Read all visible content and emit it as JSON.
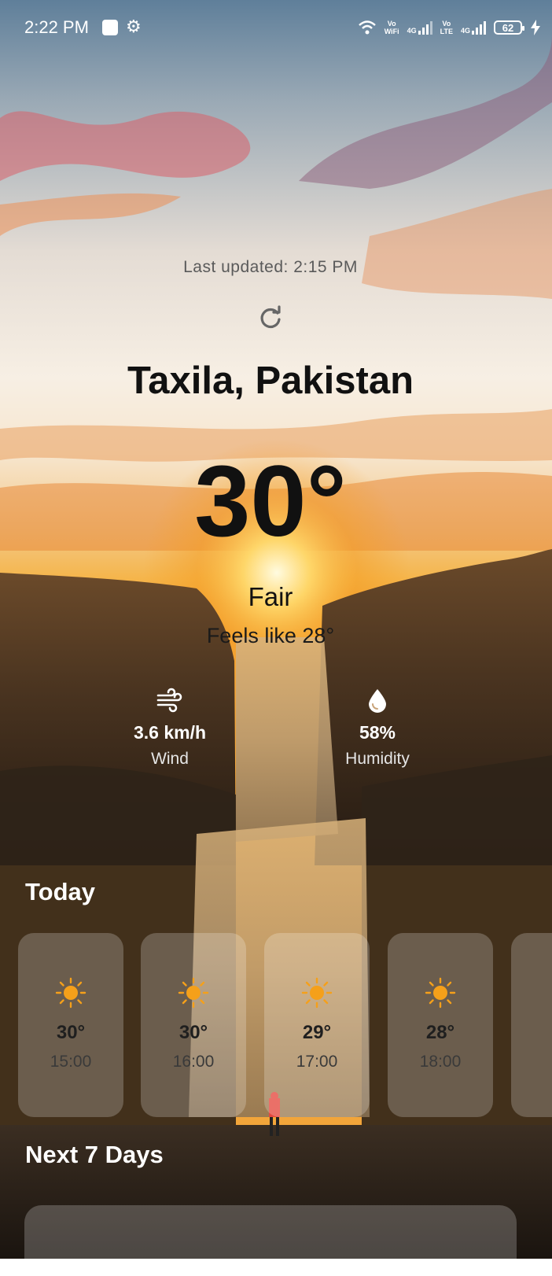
{
  "status_bar": {
    "time": "2:22 PM",
    "wifi_label_top": "Vo",
    "wifi_label_bottom": "WiFi",
    "network_1": "4G",
    "lte_label_top": "Vo",
    "lte_label_bottom": "LTE",
    "network_2": "4G",
    "battery": "62"
  },
  "weather": {
    "last_updated": "Last updated: 2:15 PM",
    "city": "Taxila, Pakistan",
    "temperature": "30°",
    "condition": "Fair",
    "feels_like": "Feels like 28°",
    "wind_value": "3.6 km/h",
    "wind_label": "Wind",
    "humidity_value": "58%",
    "humidity_label": "Humidity"
  },
  "today": {
    "title": "Today",
    "hours": [
      {
        "temp": "30°",
        "time": "15:00",
        "icon": "sun-icon"
      },
      {
        "temp": "30°",
        "time": "16:00",
        "icon": "sun-icon"
      },
      {
        "temp": "29°",
        "time": "17:00",
        "icon": "sun-icon"
      },
      {
        "temp": "28°",
        "time": "18:00",
        "icon": "sun-icon"
      }
    ]
  },
  "next_days": {
    "title": "Next 7 Days"
  },
  "colors": {
    "sun_icon": "#f5a01a",
    "text_dark": "#111111",
    "card_bg": "rgba(255,255,255,0.22)"
  }
}
